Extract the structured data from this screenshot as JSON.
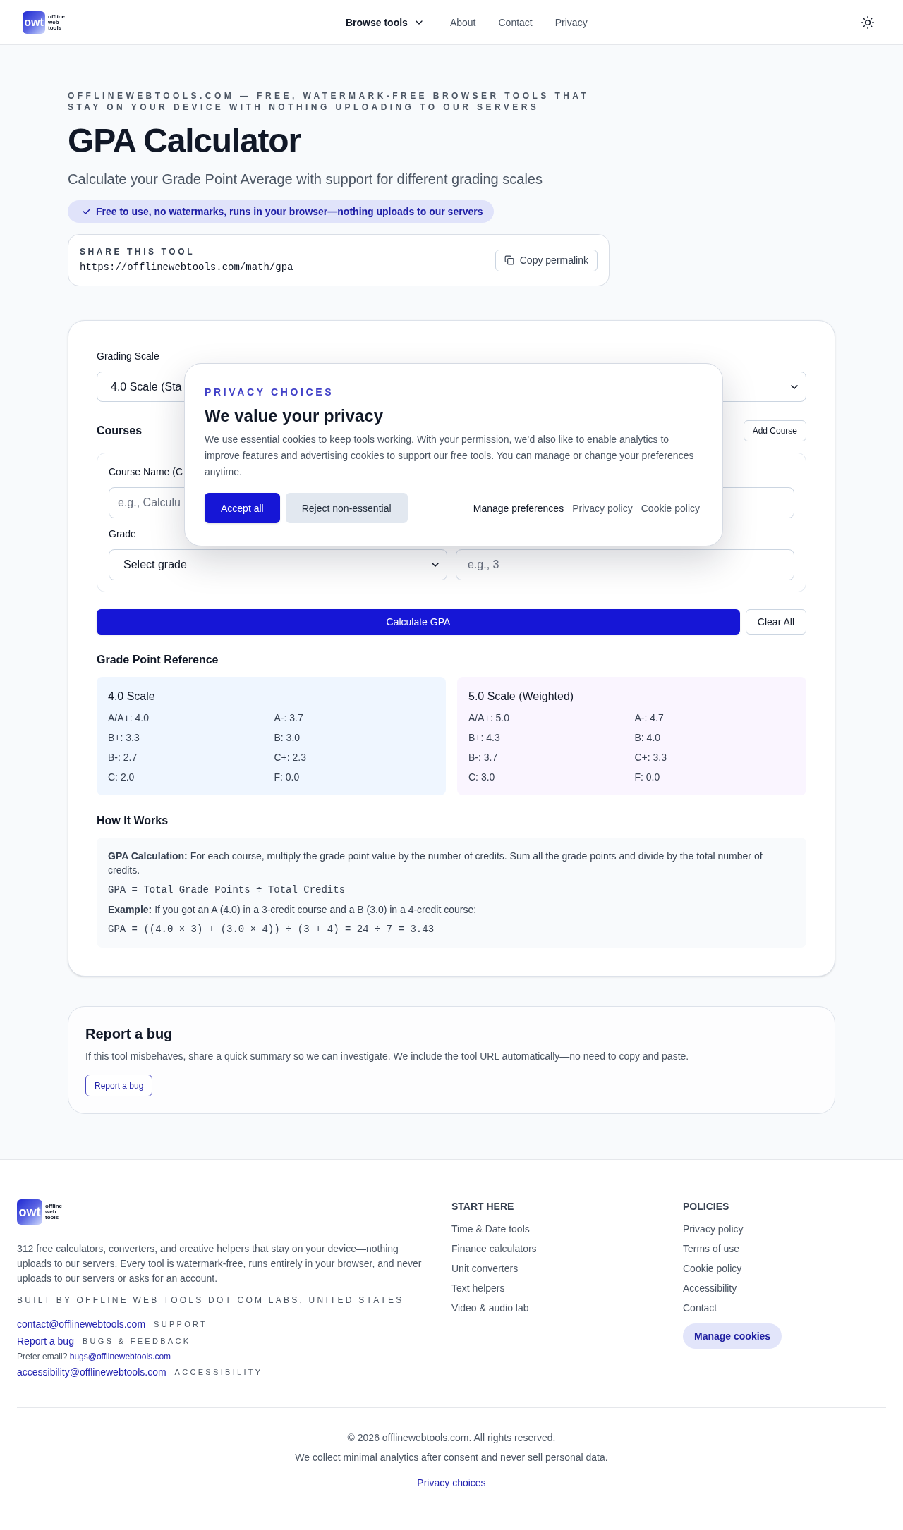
{
  "header": {
    "logo": {
      "mark": "owt",
      "wordmark": "offline web tools"
    },
    "nav": [
      {
        "label": "Browse tools",
        "kind": "menu"
      },
      {
        "label": "About",
        "kind": "link"
      },
      {
        "label": "Contact",
        "kind": "link"
      },
      {
        "label": "Privacy",
        "kind": "link"
      }
    ]
  },
  "hero": {
    "eyebrow": "OFFLINEWEBTOOLS.COM — FREE, WATERMARK-FREE BROWSER TOOLS THAT STAY ON YOUR DEVICE WITH NOTHING UPLOADING TO OUR SERVERS",
    "title": "GPA Calculator",
    "subtitle": "Calculate your Grade Point Average with support for different grading scales",
    "badge": "Free to use, no watermarks, runs in your browser—nothing uploads to our servers",
    "share": {
      "label": "SHARE THIS TOOL",
      "url": "https://offlinewebtools.com/math/gpa",
      "button": "Copy permalink"
    }
  },
  "calculator": {
    "grading_scale": {
      "label": "Grading Scale",
      "value": "4.0 Scale (Sta"
    },
    "courses": {
      "heading": "Courses",
      "add_button": "Add Course",
      "rows": [
        {
          "course_name": {
            "label": "Course Name (C",
            "placeholder": "e.g., Calculu"
          },
          "grade": {
            "label": "Grade",
            "value": "Select grade"
          },
          "credits": {
            "placeholder": "e.g., 3"
          }
        }
      ]
    },
    "actions": [
      {
        "label": "Calculate GPA",
        "kind": "primary"
      },
      {
        "label": "Clear All",
        "kind": "secondary"
      }
    ],
    "reference": {
      "heading": "Grade Point Reference",
      "scales": [
        {
          "title": "4.0 Scale",
          "color": "#eff6ff",
          "items": [
            "A/A+: 4.0",
            "A-: 3.7",
            "B+: 3.3",
            "B: 3.0",
            "B-: 2.7",
            "C+: 2.3",
            "C: 2.0",
            "F: 0.0"
          ]
        },
        {
          "title": "5.0 Scale (Weighted)",
          "color": "#faf5ff",
          "items": [
            "A/A+: 5.0",
            "A-: 4.7",
            "B+: 4.3",
            "B: 4.0",
            "B-: 3.7",
            "C+: 3.3",
            "C: 3.0",
            "F: 0.0"
          ]
        }
      ]
    },
    "how_it_works": {
      "heading": "How It Works",
      "blocks": [
        {
          "kind": "text",
          "text": "**GPA Calculation:** For each course, multiply the grade point value by the number of credits. Sum all the grade points and divide by the total number of credits."
        },
        {
          "kind": "formula",
          "text": "GPA = Total Grade Points ÷ Total Credits"
        },
        {
          "kind": "text",
          "text": "**Example:** If you got an A (4.0) in a 3-credit course and a B (3.0) in a 4-credit course:"
        },
        {
          "kind": "formula",
          "text": "GPA = ((4.0 × 3) + (3.0 × 4)) ÷ (3 + 4) = 24 ÷ 7 = 3.43"
        }
      ]
    }
  },
  "privacy_dialog": {
    "eyebrow": "PRIVACY CHOICES",
    "title": "We value your privacy",
    "text": "We use essential cookies to keep tools working. With your permission, we’d also like to enable analytics to improve features and advertising cookies to support our free tools. You can manage or change your preferences anytime.",
    "buttons": [
      {
        "label": "Accept all",
        "kind": "primary"
      },
      {
        "label": "Reject non-essential",
        "kind": "secondary"
      }
    ],
    "links": [
      {
        "label": "Manage preferences",
        "kind": "strong"
      },
      {
        "label": "Privacy policy",
        "kind": "plain"
      },
      {
        "label": "Cookie policy",
        "kind": "plain"
      }
    ]
  },
  "report_bug": {
    "title": "Report a bug",
    "text": "If this tool misbehaves, share a quick summary so we can investigate. We include the tool URL automatically—no need to copy and paste.",
    "button": "Report a bug"
  },
  "footer": {
    "logo": {
      "mark": "owt",
      "wordmark": "offline web tools"
    },
    "description": "312 free calculators, converters, and creative helpers that stay on your device—nothing uploads to our servers. Every tool is watermark-free, runs entirely in your browser, and never uploads to our servers or asks for an account.",
    "credit": "BUILT BY OFFLINE WEB TOOLS DOT COM LABS, UNITED STATES",
    "contacts": [
      {
        "kind": "email",
        "link": "contact@offlinewebtools.com",
        "tag": "SUPPORT"
      },
      {
        "kind": "page",
        "link": "Report a bug",
        "tag": "BUGS & FEEDBACK"
      },
      {
        "kind": "note",
        "text": "Prefer email?",
        "link": "bugs@offlinewebtools.com"
      },
      {
        "kind": "email",
        "link": "accessibility@offlinewebtools.com",
        "tag": "ACCESSIBILITY"
      }
    ],
    "columns": [
      {
        "heading": "START HERE",
        "links": [
          "Time & Date tools",
          "Finance calculators",
          "Unit converters",
          "Text helpers",
          "Video & audio lab"
        ]
      },
      {
        "heading": "POLICIES",
        "links": [
          "Privacy policy",
          "Terms of use",
          "Cookie policy",
          "Accessibility",
          "Contact"
        ],
        "button": "Manage cookies"
      }
    ],
    "copyright": "© 2026 offlinewebtools.com. All rights reserved.",
    "notice": "We collect minimal analytics after consent and never sell personal data.",
    "privacy_link": "Privacy choices"
  }
}
